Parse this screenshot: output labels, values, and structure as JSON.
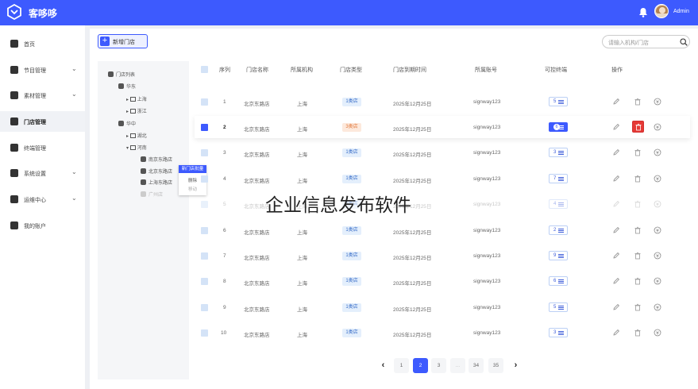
{
  "app": {
    "title": "客哆哆",
    "user": "Admin"
  },
  "sidebar": {
    "items": [
      {
        "label": "首页",
        "icon": "home-icon",
        "chevron": false
      },
      {
        "label": "节目管理",
        "icon": "program-icon",
        "chevron": true
      },
      {
        "label": "素材管理",
        "icon": "layers-icon",
        "chevron": true
      },
      {
        "label": "门店管理",
        "icon": "store-icon",
        "chevron": false,
        "active": true
      },
      {
        "label": "终端管理",
        "icon": "monitor-icon",
        "chevron": false
      },
      {
        "label": "系统设置",
        "icon": "gear-icon",
        "chevron": true
      },
      {
        "label": "运维中心",
        "icon": "ops-icon",
        "chevron": true
      },
      {
        "label": "我的账户",
        "icon": "user-icon",
        "chevron": false
      }
    ]
  },
  "toolbar": {
    "add_label": "新增门店",
    "search_placeholder": "请输入机构/门店"
  },
  "tree": {
    "root": "门店列表",
    "nodes": {
      "huadong": "华东",
      "shanghai": "上海",
      "zhejiang": "浙江",
      "huazhong": "华中",
      "hubei": "湖北",
      "henan": "河南",
      "store1": "南京东路店",
      "store2": "北京东路店",
      "store3": "上海东路店",
      "store4": "广州店"
    },
    "context_menu": {
      "head": "新门店批量",
      "item1": "删除",
      "item2": "移动"
    }
  },
  "table": {
    "columns": [
      "序列",
      "门店名称",
      "所属机构",
      "门店类型",
      "门店到期时间",
      "所属账号",
      "可控终端",
      "操作"
    ],
    "rows": [
      {
        "no": "1",
        "name": "北京东路店",
        "org": "上海",
        "type": "1类店",
        "expire": "2025年12月25日",
        "account": "signway123",
        "terminals": "5"
      },
      {
        "no": "2",
        "name": "北京东路店",
        "org": "上海",
        "type": "3类店",
        "expire": "2025年12月25日",
        "account": "signway123",
        "terminals": "6"
      },
      {
        "no": "3",
        "name": "北京东路店",
        "org": "上海",
        "type": "1类店",
        "expire": "2025年12月25日",
        "account": "signway123",
        "terminals": "3"
      },
      {
        "no": "4",
        "name": "北京东路店",
        "org": "上海",
        "type": "1类店",
        "expire": "2025年12月25日",
        "account": "signway123",
        "terminals": "7"
      },
      {
        "no": "5",
        "name": "北京东路店",
        "org": "上海",
        "type": "1类店",
        "expire": "2025年12月25日",
        "account": "signway123",
        "terminals": "4"
      },
      {
        "no": "6",
        "name": "北京东路店",
        "org": "上海",
        "type": "1类店",
        "expire": "2025年12月25日",
        "account": "signway123",
        "terminals": "2"
      },
      {
        "no": "7",
        "name": "北京东路店",
        "org": "上海",
        "type": "1类店",
        "expire": "2025年12月25日",
        "account": "signway123",
        "terminals": "9"
      },
      {
        "no": "8",
        "name": "北京东路店",
        "org": "上海",
        "type": "1类店",
        "expire": "2025年12月25日",
        "account": "signway123",
        "terminals": "6"
      },
      {
        "no": "9",
        "name": "北京东路店",
        "org": "上海",
        "type": "1类店",
        "expire": "2025年12月25日",
        "account": "signway123",
        "terminals": "5"
      },
      {
        "no": "10",
        "name": "北京东路店",
        "org": "上海",
        "type": "1类店",
        "expire": "2025年12月25日",
        "account": "signway123",
        "terminals": "3"
      }
    ]
  },
  "pagination": {
    "pages": [
      "1",
      "2",
      "3",
      "...",
      "34",
      "35"
    ],
    "current": "2",
    "prev": "‹",
    "next": "›"
  },
  "watermark": "企业信息发布软件",
  "colors": {
    "accent": "#3d5afe",
    "danger": "#e53935",
    "type_badge": "#e4effc",
    "type_badge_alt": "#fde9dc"
  }
}
